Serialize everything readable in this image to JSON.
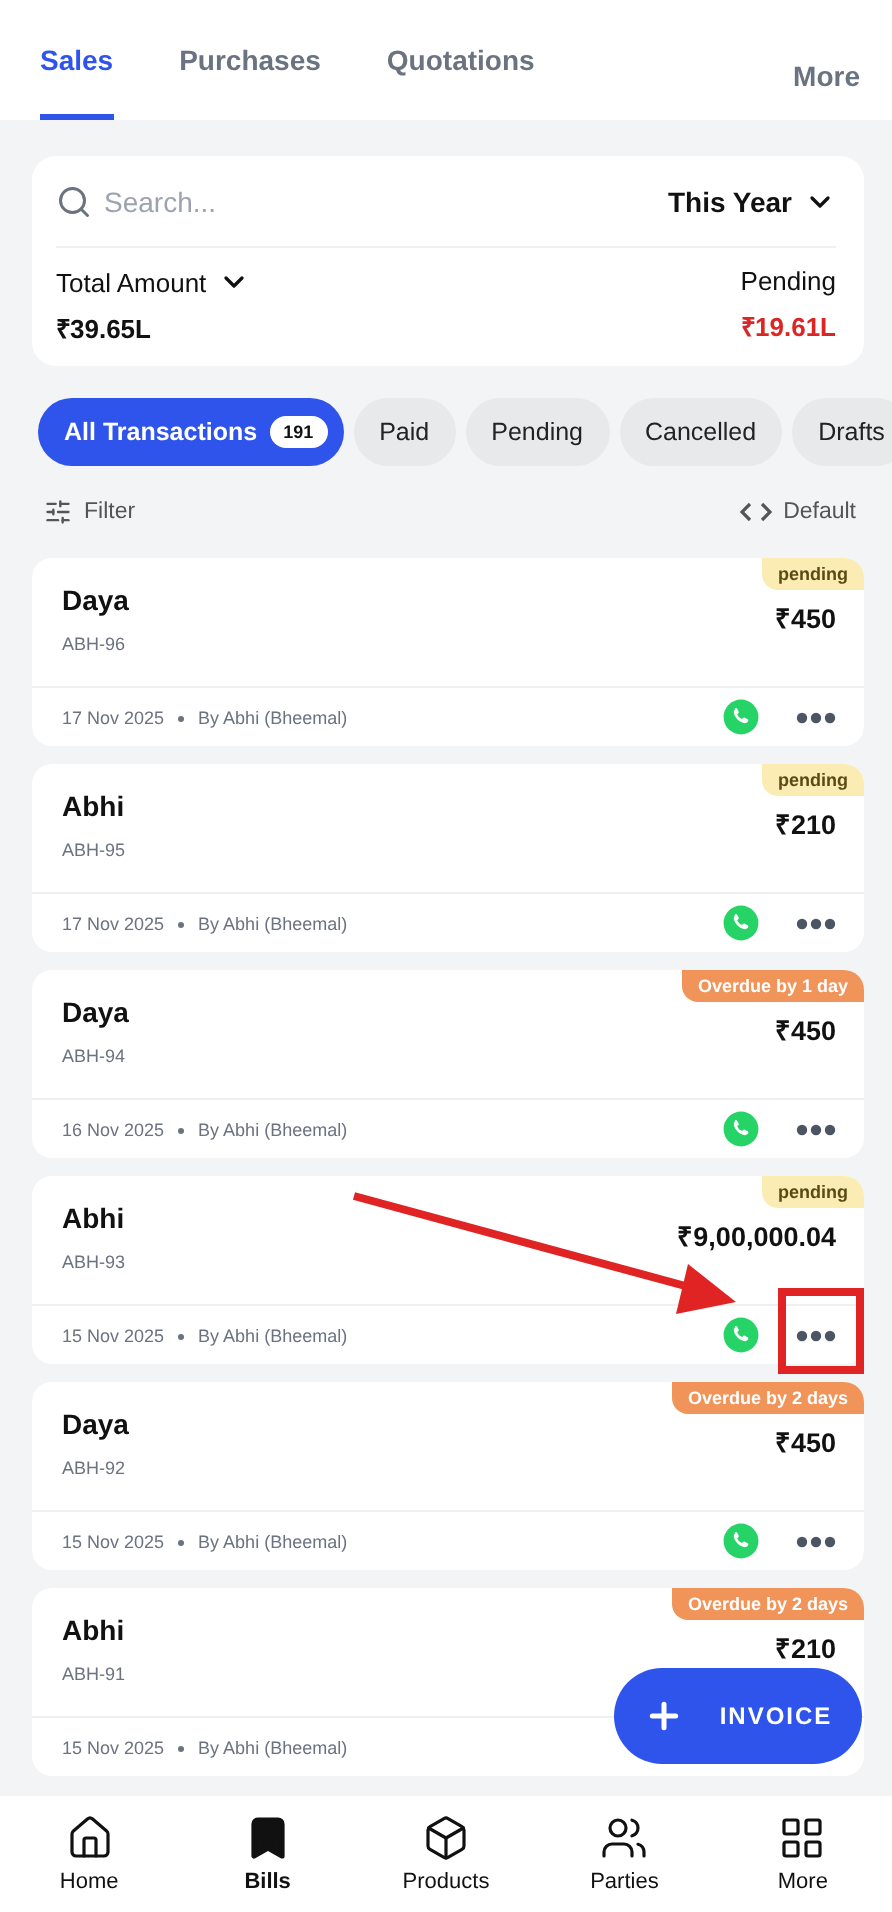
{
  "tabs": [
    {
      "label": "Sales",
      "selected": true
    },
    {
      "label": "Purchases",
      "selected": false
    },
    {
      "label": "Quotations",
      "selected": false
    }
  ],
  "more_tab": "More",
  "summary": {
    "search_placeholder": "Search...",
    "period": "This Year",
    "total_label": "Total Amount",
    "total_value": "₹39.65L",
    "pending_label": "Pending",
    "pending_value": "₹19.61L"
  },
  "chips": [
    {
      "label": "All Transactions",
      "count": "191",
      "selected": true
    },
    {
      "label": "Paid",
      "selected": false
    },
    {
      "label": "Pending",
      "selected": false
    },
    {
      "label": "Cancelled",
      "selected": false
    },
    {
      "label": "Drafts",
      "selected": false
    }
  ],
  "filter": "Filter",
  "sort": "Default",
  "bills": [
    {
      "name": "Daya",
      "number": "ABH-96",
      "badge": "pending",
      "kind": "pending",
      "amount": "₹450",
      "date": "17 Nov 2025",
      "by": "By Abhi (Bheemal)",
      "highlighted": false
    },
    {
      "name": "Abhi",
      "number": "ABH-95",
      "badge": "pending",
      "kind": "pending",
      "amount": "₹210",
      "date": "17 Nov 2025",
      "by": "By Abhi (Bheemal)",
      "highlighted": false
    },
    {
      "name": "Daya",
      "number": "ABH-94",
      "badge": "Overdue by 1 day",
      "kind": "overdue",
      "amount": "₹450",
      "date": "16 Nov 2025",
      "by": "By Abhi (Bheemal)",
      "highlighted": false
    },
    {
      "name": "Abhi",
      "number": "ABH-93",
      "badge": "pending",
      "kind": "pending",
      "amount": "₹9,00,000.04",
      "date": "15 Nov 2025",
      "by": "By Abhi (Bheemal)",
      "highlighted": true
    },
    {
      "name": "Daya",
      "number": "ABH-92",
      "badge": "Overdue by 2 days",
      "kind": "overdue",
      "amount": "₹450",
      "date": "15 Nov 2025",
      "by": "By Abhi (Bheemal)",
      "highlighted": false
    },
    {
      "name": "Abhi",
      "number": "ABH-91",
      "badge": "Overdue by 2 days",
      "kind": "overdue",
      "amount": "₹210",
      "date": "15 Nov 2025",
      "by": "By Abhi (Bheemal)",
      "highlighted": false
    }
  ],
  "fab": "INVOICE",
  "nav": [
    {
      "label": "Home",
      "selected": false
    },
    {
      "label": "Bills",
      "selected": true
    },
    {
      "label": "Products",
      "selected": false
    },
    {
      "label": "Parties",
      "selected": false
    },
    {
      "label": "More",
      "selected": false
    }
  ]
}
